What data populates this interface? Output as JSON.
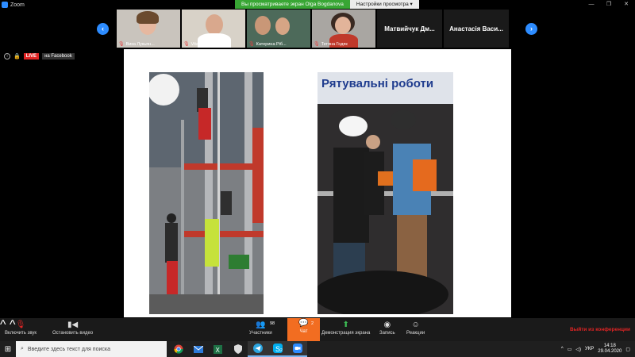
{
  "window": {
    "app_title": "Zoom",
    "share_message": "Вы просматриваете экран Olga Bogdanova",
    "view_options": "Настройки просмотра ▾",
    "controls": [
      "—",
      "❐",
      "✕"
    ]
  },
  "gallery": {
    "participants": [
      {
        "name": "Вика Лукьян..."
      },
      {
        "name": "Vitalii Yermol..."
      },
      {
        "name": "Катерина Ріб..."
      },
      {
        "name": "Тетяна Годяк"
      },
      {
        "name": "Матвийчук  Дм..."
      },
      {
        "name": "Анастасія Васи..."
      }
    ]
  },
  "live": {
    "badge": "LIVE",
    "target": "на Facebook"
  },
  "slide": {
    "title": "Рятувальні роботи"
  },
  "toolbar": {
    "mute_label": "Включить звук",
    "video_label": "Остановить видео",
    "participants_label": "Участники",
    "participants_count": "98",
    "chat_label": "Чат",
    "chat_count": "2",
    "share_label": "Демонстрация экрана",
    "record_label": "Запись",
    "reactions_label": "Реакции",
    "leave_label": "Выйти из конференции"
  },
  "taskbar": {
    "search_placeholder": "Введите здесь текст для поиска",
    "apps": [
      {
        "icon": "chrome-icon"
      },
      {
        "icon": "mail-icon"
      },
      {
        "icon": "excel-icon"
      },
      {
        "icon": "shield-icon"
      },
      {
        "icon": "telegram-icon"
      },
      {
        "icon": "skype-icon",
        "badge": "2"
      },
      {
        "icon": "zoom-icon"
      }
    ],
    "language": "УКР",
    "time": "14:18",
    "date": "29.04.2020"
  }
}
